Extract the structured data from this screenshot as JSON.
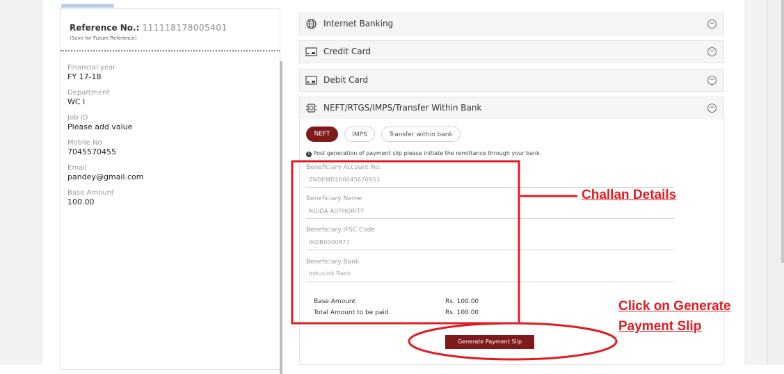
{
  "left": {
    "reference_label": "Reference No.:",
    "reference_value": "111118178005401",
    "reference_note": "(Save for Future Reference)",
    "fields": [
      {
        "label": "Financial year",
        "value": "FY 17-18"
      },
      {
        "label": "Department",
        "value": "WC I"
      },
      {
        "label": "Job ID",
        "value": "Please add value"
      },
      {
        "label": "Mobile No",
        "value": "7045570455"
      },
      {
        "label": "Email",
        "value": "pandey@gmail.com"
      },
      {
        "label": "Base Amount",
        "value": "100.00"
      }
    ]
  },
  "accordions": [
    {
      "label": "Internet Banking",
      "icon": "globe-icon",
      "toggle": "⊖"
    },
    {
      "label": "Credit Card",
      "icon": "credit-card-icon",
      "toggle": "⊖"
    },
    {
      "label": "Debit Card",
      "icon": "debit-card-icon",
      "toggle": "⊖"
    },
    {
      "label": "NEFT/RTGS/IMPS/Transfer Within Bank",
      "icon": "bank-transfer-icon",
      "toggle": "⊖"
    }
  ],
  "tabs": {
    "neft": "NEFT",
    "imps": "IMPS",
    "transfer": "Transfer within bank"
  },
  "notice": "Post generation of payment slip please initiate the remittance through your bank.",
  "beneficiary": [
    {
      "label": "Beneficiary Account No.",
      "value": "ZNDEMD100045676953"
    },
    {
      "label": "Beneficiary Name",
      "value": "NOIDA AUTHORITY"
    },
    {
      "label": "Beneficiary IFSC Code",
      "value": "INDB0000877"
    },
    {
      "label": "Beneficiary Bank",
      "value": "Indusind Bank"
    }
  ],
  "summary": {
    "base_label": "Base Amount",
    "base_value": "Rs. 100.00",
    "total_label": "Total Amount to be paid",
    "total_value": "Rs. 100.00"
  },
  "button_label": "Generate Payment Slip",
  "annotations": {
    "challan": "Challan Details",
    "click_line1": "Click on Generate",
    "click_line2": "Payment Slip"
  },
  "colors": {
    "accent": "#7e1a1a",
    "annotation": "#e01b22"
  }
}
